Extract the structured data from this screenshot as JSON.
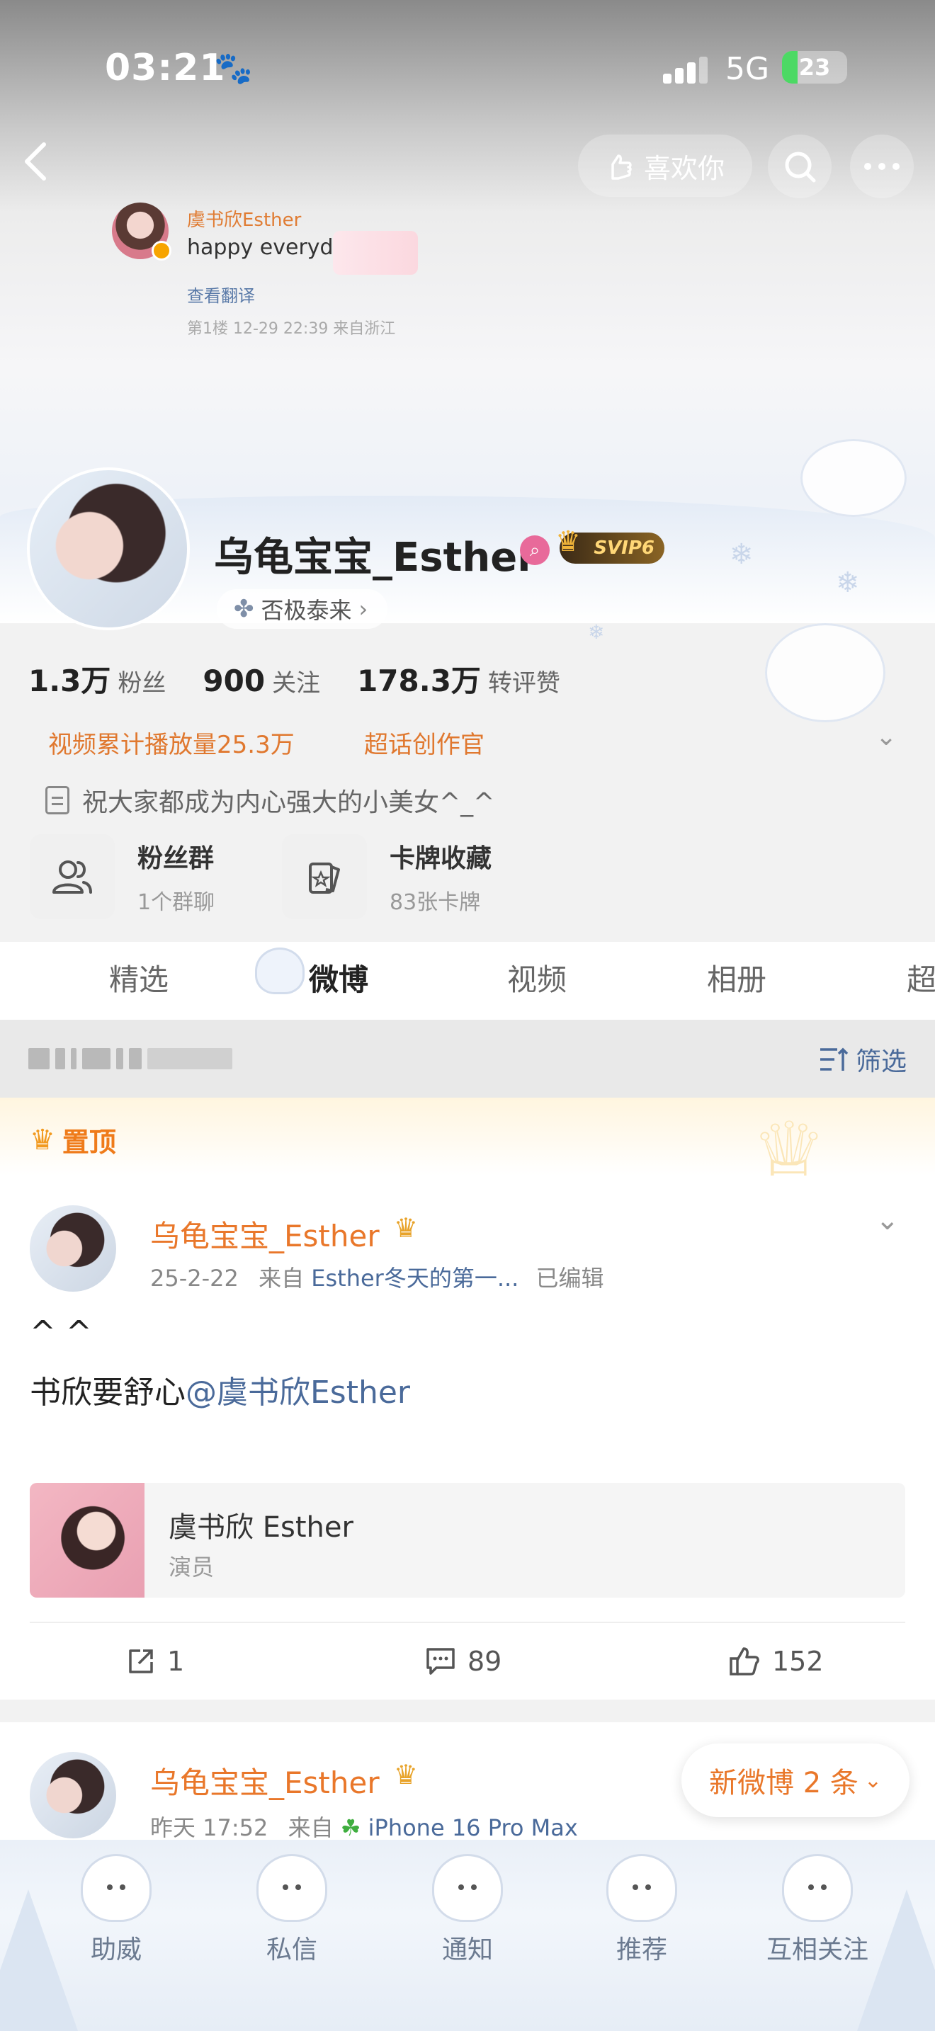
{
  "status_bar": {
    "time": "03:21",
    "network": "5G",
    "battery": "23"
  },
  "nav": {
    "like_label": "喜欢你"
  },
  "comment_snippet": {
    "author": "虞书欣Esther",
    "text": "happy everyday",
    "translate": "查看翻译",
    "meta": "第1楼 12-29 22:39 来自浙江"
  },
  "profile": {
    "name": "乌龟宝宝_Esther",
    "vip_badge": "SVIP6",
    "tag": "否极泰来",
    "stats": [
      {
        "num": "1.3万",
        "label": "粉丝"
      },
      {
        "num": "900",
        "label": "关注"
      },
      {
        "num": "178.3万",
        "label": "转评赞"
      }
    ],
    "honors": [
      "视频累计播放量25.3万",
      "超话创作官"
    ],
    "bio": "祝大家都成为内心强大的小美女^_^",
    "cards": [
      {
        "title": "粉丝群",
        "sub": "1个群聊"
      },
      {
        "title": "卡牌收藏",
        "sub": "83张卡牌"
      }
    ]
  },
  "tabs": [
    "精选",
    "微博",
    "视频",
    "相册",
    "超"
  ],
  "filter": {
    "label": "筛选"
  },
  "pinned": {
    "label": "置顶",
    "author": "乌龟宝宝_Esther",
    "date": "25-2-22",
    "source_prefix": "来自",
    "source": "Esther冬天的第一...",
    "edited": "已编辑",
    "line1": "^ ^",
    "text": "书欣要舒心",
    "mention": "@虞书欣Esther",
    "ref_title": "虞书欣 Esther",
    "ref_sub": "演员",
    "reposts": "1",
    "comments": "89",
    "likes": "152"
  },
  "post2": {
    "author": "乌龟宝宝_Esther",
    "date": "昨天 17:52",
    "source_prefix": "来自",
    "source": "iPhone 16 Pro Max"
  },
  "new_posts": "新微博 2 条",
  "bottom_bar": [
    "助威",
    "私信",
    "通知",
    "推荐",
    "互相关注"
  ],
  "colors": {
    "accent_orange": "#e9772a",
    "link_blue": "#4a6a9a",
    "pinned_orange": "#ef7b1a"
  }
}
